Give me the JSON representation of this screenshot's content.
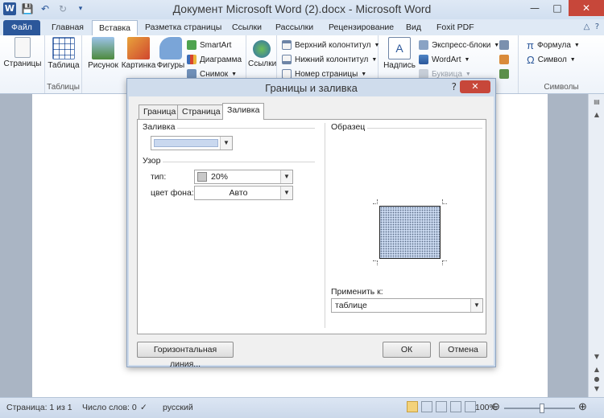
{
  "window": {
    "title": "Документ Microsoft Word (2).docx  -  Microsoft Word"
  },
  "ribbon_tabs": [
    {
      "label": "Файл"
    },
    {
      "label": "Главная"
    },
    {
      "label": "Вставка"
    },
    {
      "label": "Разметка страницы"
    },
    {
      "label": "Ссылки"
    },
    {
      "label": "Рассылки"
    },
    {
      "label": "Рецензирование"
    },
    {
      "label": "Вид"
    },
    {
      "label": "Foxit PDF"
    }
  ],
  "ribbon": {
    "pages": "Страницы",
    "table": "Таблица",
    "tables_group": "Таблицы",
    "picture": "Рисунок",
    "clipart": "Картинка",
    "shapes": "Фигуры",
    "smartart": "SmartArt",
    "chart": "Диаграмма",
    "screenshot": "Снимок",
    "links": "Ссылки",
    "header": "Верхний колонтитул",
    "footer": "Нижний колонтитул",
    "page_number": "Номер страницы",
    "textbox": "Надпись",
    "quick_parts": "Экспресс-блоки",
    "wordart": "WordArt",
    "dropcap": "Буквица",
    "formula": "Формула",
    "symbol": "Символ",
    "symbols_group": "Символы"
  },
  "dialog": {
    "title": "Границы и заливка",
    "help": "?",
    "tabs": [
      {
        "label": "Граница"
      },
      {
        "label": "Страница"
      },
      {
        "label": "Заливка"
      }
    ],
    "fill_label": "Заливка",
    "fill_color": "#c9d8ef",
    "pattern_label": "Узор",
    "type_label": "тип:",
    "type_value": "20%",
    "bg_color_label": "цвет фона:",
    "bg_color_value": "Авто",
    "preview_label": "Образец",
    "apply_to_label": "Применить к:",
    "apply_to_value": "таблице",
    "horizontal_line_btn": "Горизонтальная линия...",
    "ok_btn": "ОК",
    "cancel_btn": "Отмена"
  },
  "status": {
    "page": "Страница: 1 из 1",
    "words": "Число слов: 0",
    "language": "русский",
    "zoom": "100%"
  }
}
